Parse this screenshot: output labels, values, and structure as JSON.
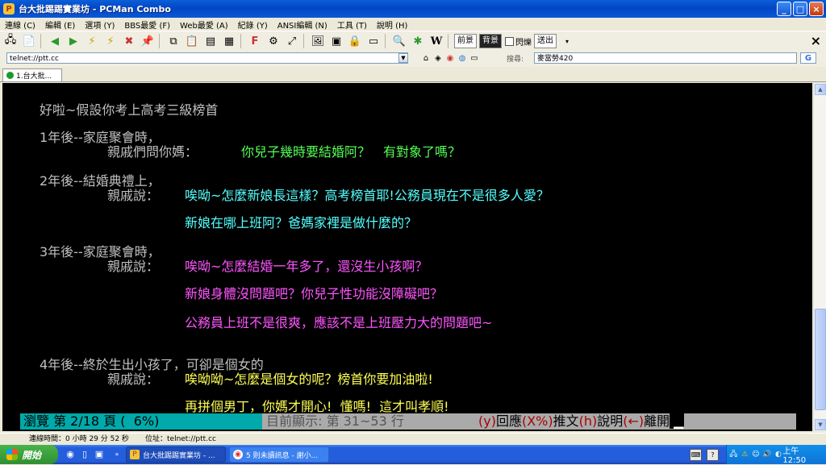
{
  "window": {
    "title": "台大批踢踢實業坊 - PCMan Combo",
    "controls": [
      "_",
      "□",
      "×"
    ]
  },
  "menu": [
    "連線 (C)",
    "編輯 (E)",
    "選項 (Y)",
    "BBS最愛 (F)",
    "Web最愛 (A)",
    "紀錄 (Y)",
    "ANSI編輯 (N)",
    "工具 (T)",
    "說明 (H)"
  ],
  "toolbar": {
    "front_label": "前景",
    "back_label": "背景",
    "blink_label": "閃爍",
    "send_label": "送出"
  },
  "address": {
    "value": "telnet://ptt.cc",
    "search_label": "搜尋:",
    "search_value": "麥當勞420",
    "search_engine": "G"
  },
  "tab": {
    "label": "1.台大批..."
  },
  "terminal": {
    "title": "好啦~假設你考上高考三級榜首",
    "y1_head": "1年後--家庭聚會時，",
    "y1_speaker": "親戚們問你媽：",
    "y1_text": "你兒子幾時要結婚阿？　有對象了嗎？",
    "y2_head": "2年後--結婚典禮上，",
    "y2_speaker": "親戚說：",
    "y2_text1": "唉呦~怎麼新娘長這樣？高考榜首耶!公務員現在不是很多人愛？",
    "y2_text2": "新娘在哪上班阿？爸媽家裡是做什麼的？",
    "y3_head": "3年後--家庭聚會時，",
    "y3_speaker": "親戚說：",
    "y3_text1": "唉呦~怎麼結婚一年多了，還沒生小孩啊？",
    "y3_text2": "新娘身體沒問題吧？你兒子性功能沒障礙吧？",
    "y3_text3": "公務員上班不是很爽，應該不是上班壓力大的問題吧~",
    "y4_head": "4年後--終於生出小孩了，可卻是個女的",
    "y4_speaker": "親戚說：",
    "y4_text1": "唉呦呦~怎麼是個女的呢？榜首你要加油啦!",
    "y4_text2": "再拼個男丁，你媽才開心!  懂嗎!  這才叫孝順!",
    "status": {
      "browse": "瀏覽 第 2/18 頁 (  6%)",
      "showing": " 目前顯示: 第 31~53 行 ",
      "k1": "(y)",
      "a1": "回應",
      "k2": "(X%)",
      "a2": "推文",
      "k3": "(h)",
      "a3": "說明",
      "k4": "(←)",
      "a4": "離開",
      "cursor": " ▁"
    }
  },
  "statusbar": {
    "conn_time": "連線時間：0 小時 29 分 52 秒",
    "addr": "位址：telnet://ptt.cc"
  },
  "taskbar": {
    "start": "開始",
    "btn1": "台大批踢踢實業坊 - ...",
    "btn2": "5 則未讀訊息 - 謝小...",
    "clock": "上午 12:50"
  },
  "colors": {
    "terminal_bg": "#000000",
    "gray": "#c0c0c0",
    "yellow": "#ffff55",
    "green": "#55ff55",
    "cyan": "#55ffff",
    "magenta": "#ff55ff",
    "status_cyan": "#00aaaa"
  }
}
